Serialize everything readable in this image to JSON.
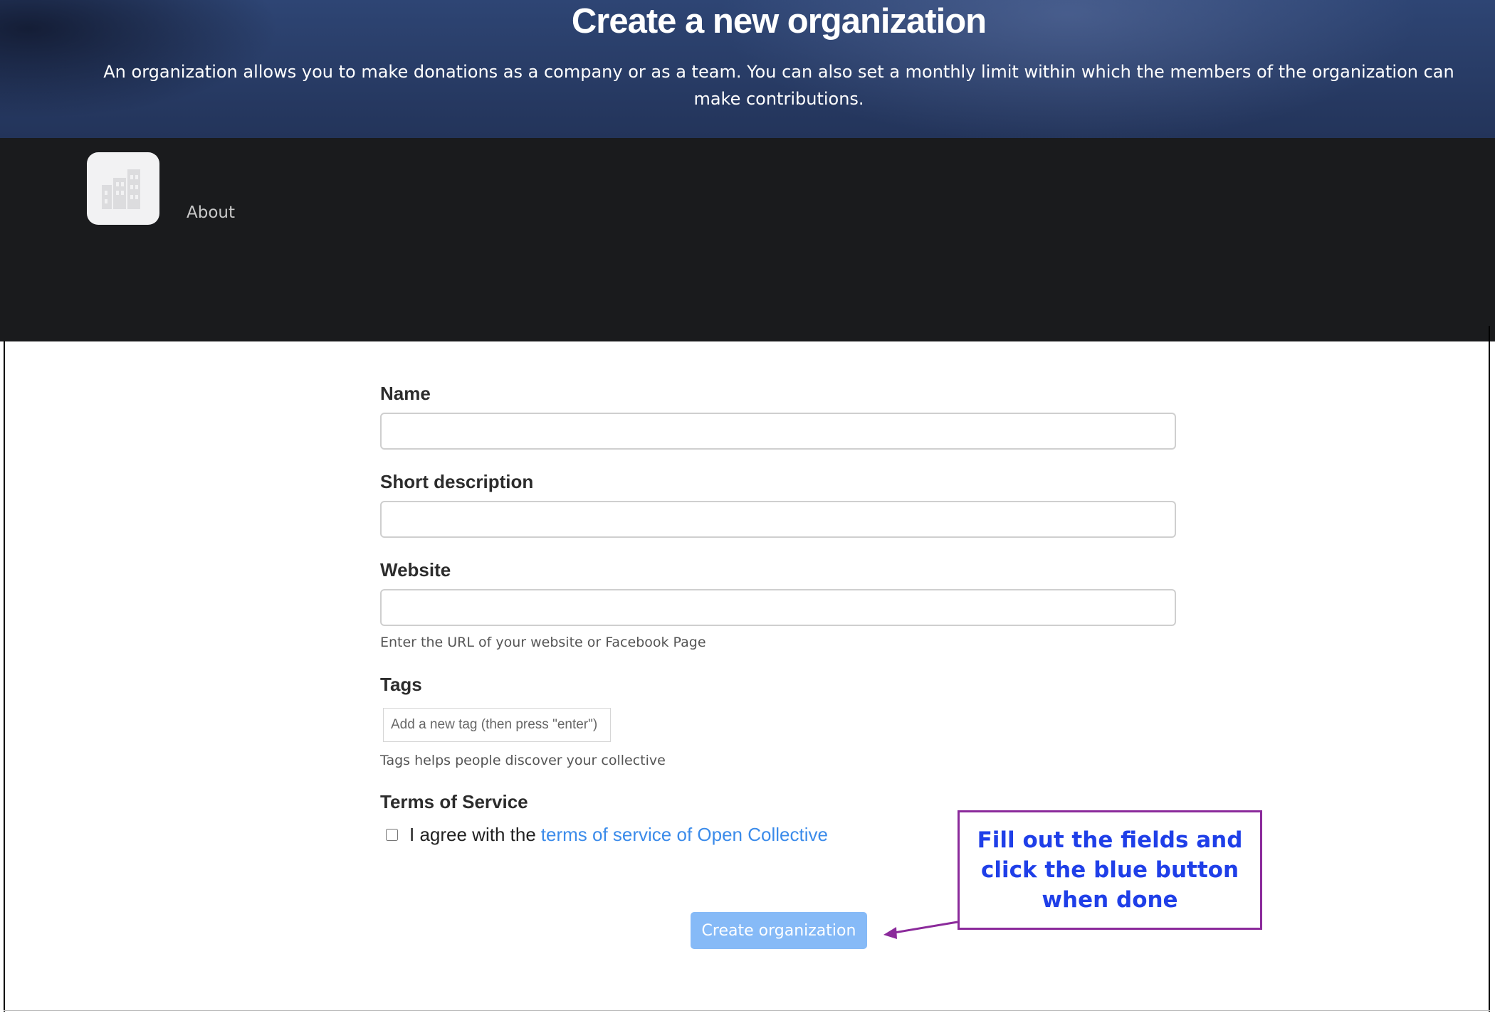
{
  "hero": {
    "title": "Create a new organization",
    "description": "An organization allows you to make donations as a company or as a team. You can also set a monthly limit within which the members of the organization can make contributions."
  },
  "nav": {
    "logo_icon": "building-icon",
    "about_label": "About"
  },
  "form": {
    "name": {
      "label": "Name",
      "value": ""
    },
    "short_description": {
      "label": "Short description",
      "value": ""
    },
    "website": {
      "label": "Website",
      "value": "",
      "help": "Enter the URL of your website or Facebook Page"
    },
    "tags": {
      "label": "Tags",
      "placeholder": "Add a new tag (then press \"enter\")",
      "help": "Tags helps people discover your collective"
    },
    "terms": {
      "label": "Terms of Service",
      "agree_text": "I agree with the",
      "link_text": "terms of service of Open Collective",
      "checked": false
    },
    "submit_label": "Create organization"
  },
  "annotation": {
    "text": "Fill out the fields and click the blue button when done",
    "border_color": "#8b2a9b",
    "text_color": "#1f3fe8"
  },
  "colors": {
    "hero_bg": "#2e4574",
    "nav_bg": "#1a1b1d",
    "link": "#3b8bea",
    "submit_bg": "#86baf7"
  }
}
